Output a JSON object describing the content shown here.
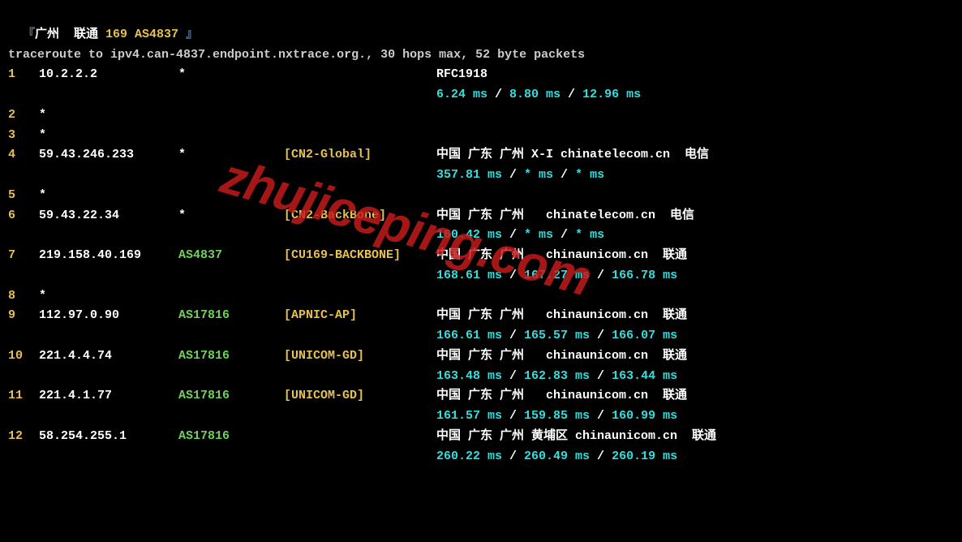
{
  "header": {
    "bracket_open": "『",
    "location": "广州  联通 ",
    "asn_text": "169 AS4837 ",
    "bracket_close": "』"
  },
  "traceroute_cmd": "traceroute to ipv4.can-4837.endpoint.nxtrace.org., 30 hops max, 52 byte packets",
  "hops": [
    {
      "num": "1",
      "ip": "10.2.2.2",
      "asn": "*",
      "tag": "",
      "loc": "RFC1918",
      "t1": "6.24 ms",
      "t2": "8.80 ms",
      "t3": "12.96 ms"
    },
    {
      "num": "2",
      "ip": "*",
      "asn": "",
      "tag": "",
      "loc": "",
      "t1": "",
      "t2": "",
      "t3": ""
    },
    {
      "num": "3",
      "ip": "*",
      "asn": "",
      "tag": "",
      "loc": "",
      "t1": "",
      "t2": "",
      "t3": ""
    },
    {
      "num": "4",
      "ip": "59.43.246.233",
      "asn": "*",
      "tag": "[CN2-Global]",
      "loc": "中国 广东 广州 ",
      "accent": "X-I",
      "isp": " chinatelecom.cn  电信",
      "t1": "357.81 ms",
      "t2": "* ms",
      "t3": "* ms"
    },
    {
      "num": "5",
      "ip": "*",
      "asn": "",
      "tag": "",
      "loc": "",
      "t1": "",
      "t2": "",
      "t3": ""
    },
    {
      "num": "6",
      "ip": "59.43.22.34",
      "asn": "*",
      "tag": "[CN2-BackBone]",
      "loc": "中国 广东 广州   chinatelecom.cn  电信",
      "t1": "160.42 ms",
      "t2": "* ms",
      "t3": "* ms"
    },
    {
      "num": "7",
      "ip": "219.158.40.169",
      "asn": "AS4837",
      "asn_green": true,
      "tag": "[CU169-BACKBONE]",
      "loc": "中国 广东 广州   chinaunicom.cn  联通",
      "t1": "168.61 ms",
      "t2": "167.27 ms",
      "t3": "166.78 ms"
    },
    {
      "num": "8",
      "ip": "*",
      "asn": "",
      "tag": "",
      "loc": "",
      "t1": "",
      "t2": "",
      "t3": ""
    },
    {
      "num": "9",
      "ip": "112.97.0.90",
      "asn": "AS17816",
      "asn_green": true,
      "tag": "[APNIC-AP]",
      "loc": "中国 广东 广州   chinaunicom.cn  联通",
      "t1": "166.61 ms",
      "t2": "165.57 ms",
      "t3": "166.07 ms"
    },
    {
      "num": "10",
      "ip": "221.4.4.74",
      "asn": "AS17816",
      "asn_green": true,
      "tag": "[UNICOM-GD]",
      "loc": "中国 广东 广州   chinaunicom.cn  联通",
      "t1": "163.48 ms",
      "t2": "162.83 ms",
      "t3": "163.44 ms"
    },
    {
      "num": "11",
      "ip": "221.4.1.77",
      "asn": "AS17816",
      "asn_green": true,
      "tag": "[UNICOM-GD]",
      "loc": "中国 广东 广州   chinaunicom.cn  联通",
      "t1": "161.57 ms",
      "t2": "159.85 ms",
      "t3": "160.99 ms"
    },
    {
      "num": "12",
      "ip": "58.254.255.1",
      "asn": "AS17816",
      "asn_green": true,
      "tag": "",
      "loc": "中国 广东 广州 黄埔区 chinaunicom.cn  联通",
      "t1": "260.22 ms",
      "t2": "260.49 ms",
      "t3": "260.19 ms"
    }
  ],
  "watermark": "zhujiceping.com",
  "sep": " / "
}
